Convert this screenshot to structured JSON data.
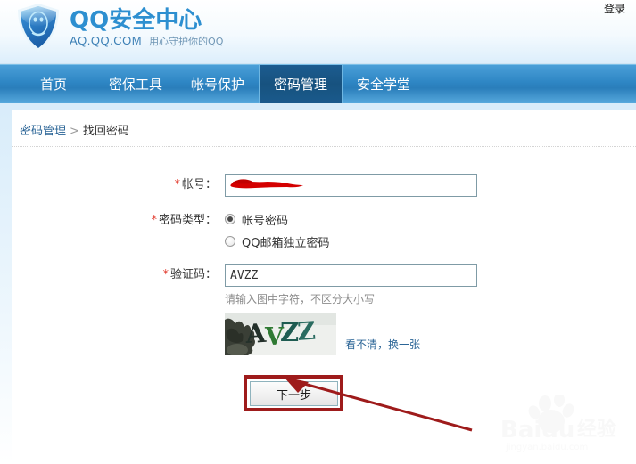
{
  "header": {
    "brand_title": "QQ安全中心",
    "brand_domain": "AQ.QQ.COM",
    "brand_slogan": "用心守护你的QQ",
    "login_label": "登录",
    "logo_icon": "shield-qq-icon",
    "brand_color": "#2d8fd0"
  },
  "nav": {
    "items": [
      {
        "label": "首页",
        "active": false
      },
      {
        "label": "密保工具",
        "active": false
      },
      {
        "label": "帐号保护",
        "active": false
      },
      {
        "label": "密码管理",
        "active": true
      },
      {
        "label": "安全学堂",
        "active": false
      }
    ],
    "bar_color": "#2e86c4",
    "active_color": "#17527f"
  },
  "breadcrumb": {
    "parent": "密码管理",
    "separator": ">",
    "current": "找回密码"
  },
  "form": {
    "required_mark": "*",
    "account": {
      "label": "帐号：",
      "value": "",
      "placeholder": "",
      "redacted": true,
      "redaction_color": "#d40000"
    },
    "password_type": {
      "label": "密码类型：",
      "options": [
        {
          "label": "帐号密码",
          "selected": true
        },
        {
          "label": "QQ邮箱独立密码",
          "selected": false
        }
      ]
    },
    "captcha": {
      "label": "验证码：",
      "value": "AVZZ",
      "placeholder": "",
      "hint": "请输入图中字符，不区分大小写",
      "image_text": "AVZZ",
      "refresh_label": "看不清，换一张"
    },
    "submit_label": "下一步"
  },
  "annotation": {
    "box_color": "#9e1b1b",
    "arrow_color": "#9e1b1b",
    "target": "下一步"
  },
  "watermark": {
    "brand": "Baidu 经验",
    "url": "jingyan.baidu.com"
  }
}
